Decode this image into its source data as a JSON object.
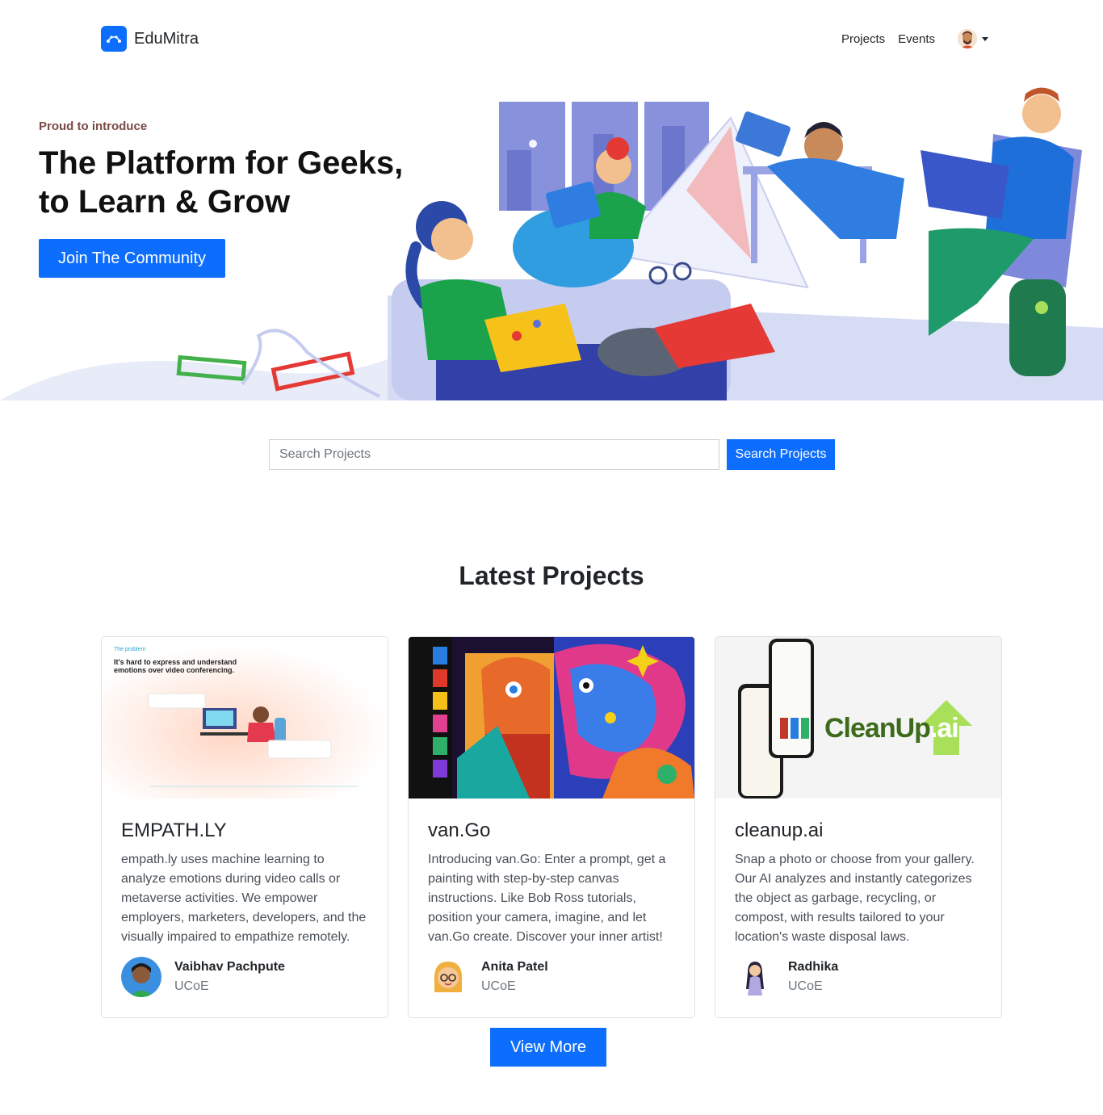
{
  "nav": {
    "brand": "EduMitra",
    "links": [
      "Projects",
      "Events"
    ]
  },
  "hero": {
    "eyebrow": "Proud to introduce",
    "title_line1": "The Platform for Geeks,",
    "title_line2": "to Learn & Grow",
    "cta": "Join The Community"
  },
  "search": {
    "placeholder": "Search Projects",
    "value": "",
    "button": "Search Projects"
  },
  "section": {
    "title": "Latest Projects"
  },
  "projects": [
    {
      "image_heading": "The problem",
      "image_subheading": "It's hard to express and understand emotions over video conferencing.",
      "title": "EMPATH.LY",
      "description": "empath.ly uses machine learning to analyze emotions during video calls or metaverse activities. We empower employers, marketers, developers, and the visually impaired to empathize remotely.",
      "author": "Vaibhav Pachpute",
      "org": "UCoE"
    },
    {
      "title": "van.Go",
      "description": "Introducing van.Go: Enter a prompt, get a painting with step-by-step canvas instructions. Like Bob Ross tutorials, position your camera, imagine, and let van.Go create. Discover your inner artist!",
      "author": "Anita Patel",
      "org": "UCoE"
    },
    {
      "image_logo_main": "CleanUp",
      "image_logo_suffix": ".ai",
      "title": "cleanup.ai",
      "description": "Snap a photo or choose from your gallery. Our AI analyzes and instantly categorizes the object as garbage, recycling, or compost, with results tailored to your location's waste disposal laws.",
      "author": "Radhika",
      "org": "UCoE"
    }
  ],
  "view_more": "View More",
  "colors": {
    "primary": "#0d6efd",
    "eyebrow": "#7b4a44",
    "cleanup_green": "#3d6b1c",
    "cleanup_accent": "#a8e05a"
  }
}
